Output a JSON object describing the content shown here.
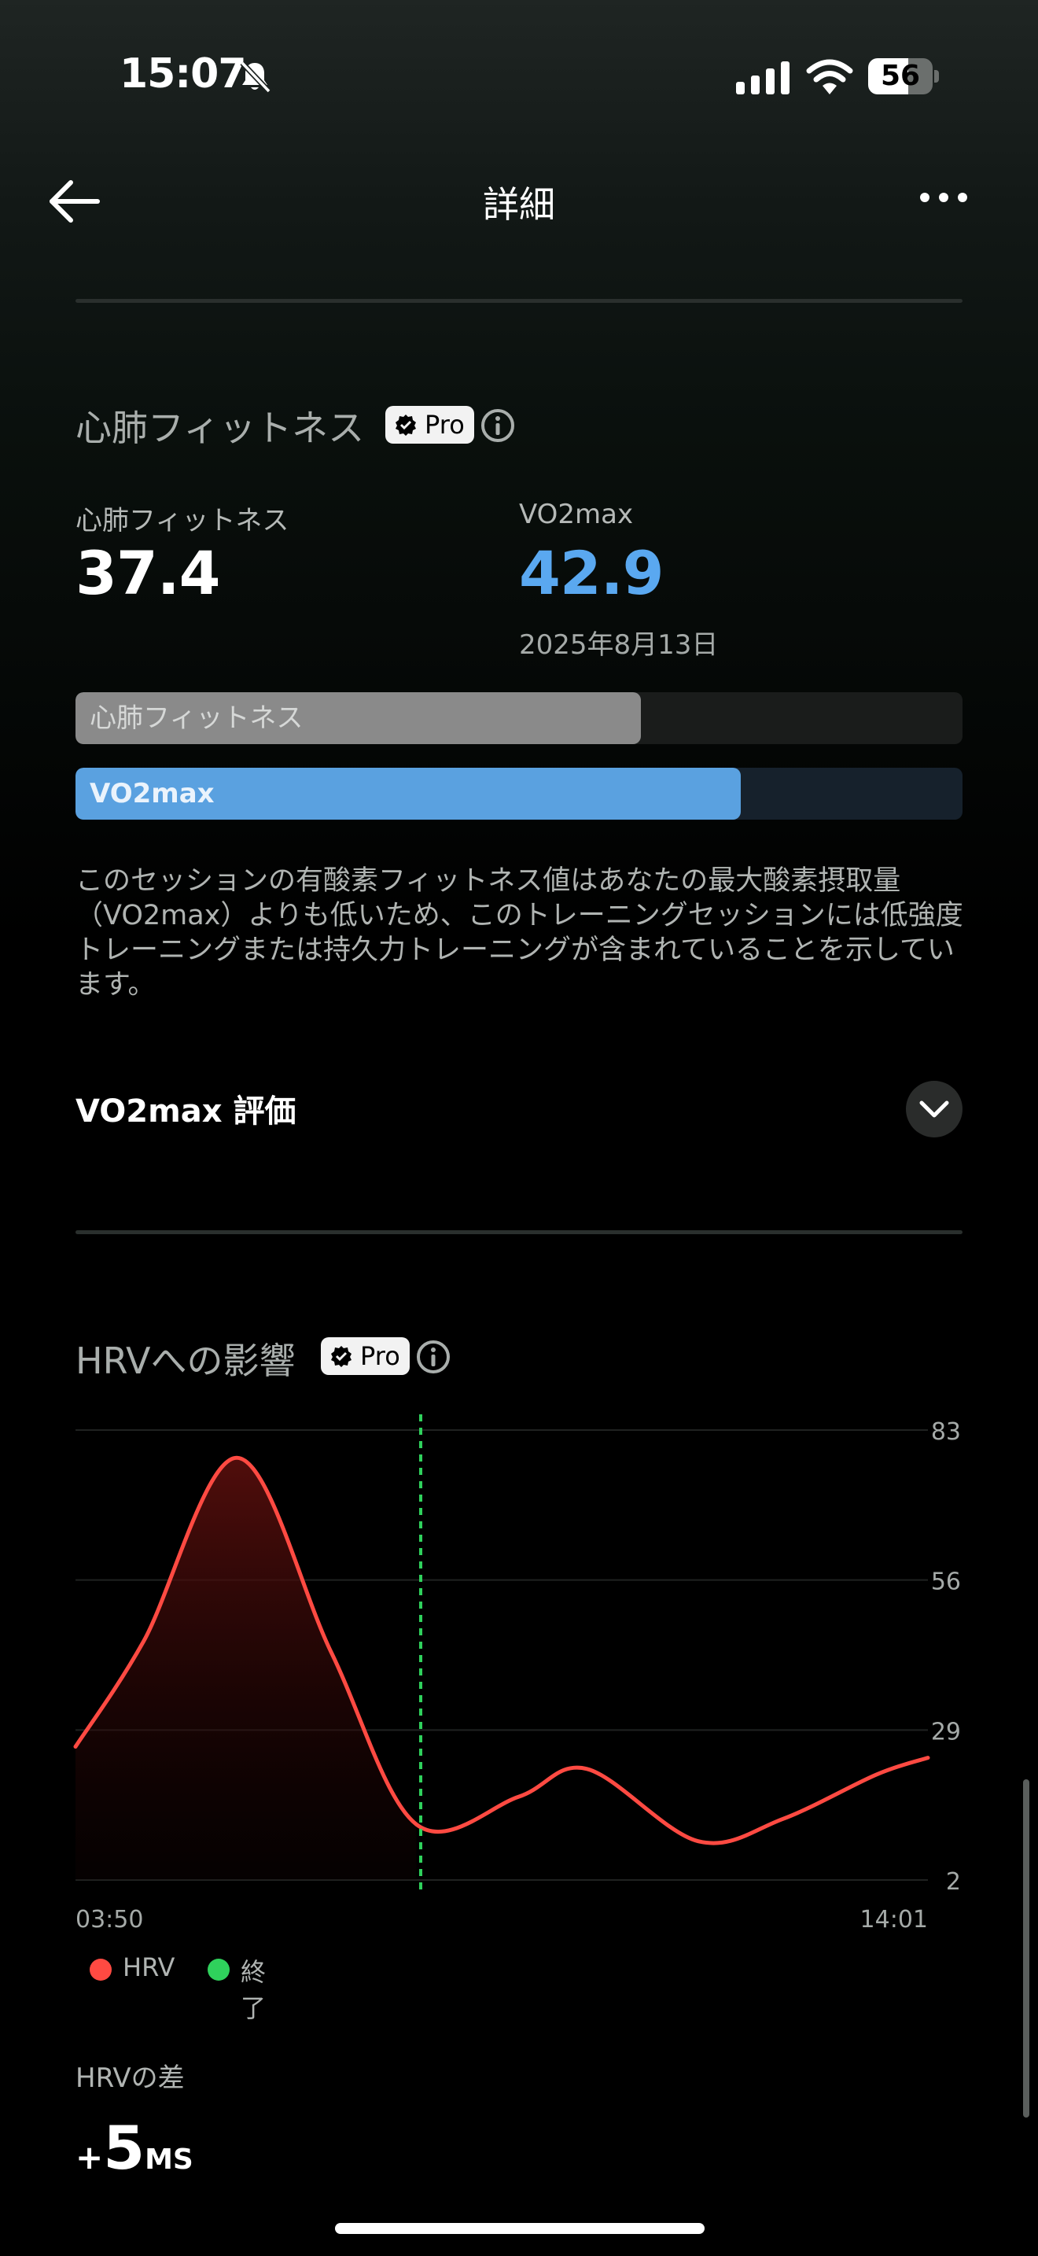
{
  "status": {
    "time": "15:07",
    "battery": "56"
  },
  "nav": {
    "title": "詳細"
  },
  "cardio": {
    "section_title": "心肺フィットネス",
    "pro_label": "Pro",
    "fitness_label": "心肺フィットネス",
    "fitness_value": "37.4",
    "vo2_label": "VO2max",
    "vo2_value": "42.9",
    "date": "2025年8月13日",
    "bars": [
      {
        "label": "心肺フィットネス",
        "fraction": 0.637,
        "fill": "#8a8a8a",
        "track": "#1a1c1b"
      },
      {
        "label": "VO2max",
        "fraction": 0.75,
        "fill": "#5aa1e0",
        "track": "#16212c"
      }
    ],
    "description": "このセッションの有酸素フィットネス値はあなたの最大酸素摂取量（VO2max）よりも低いため、このトレーニングセッションには低強度トレーニングまたは持久力トレーニングが含まれていることを示しています。",
    "vo2_rating_label": "VO2max 評価"
  },
  "hrv": {
    "section_title": "HRVへの影響",
    "pro_label": "Pro",
    "legend": [
      {
        "label": "HRV",
        "color": "#ff4a42"
      },
      {
        "label": "終了",
        "color": "#2fd15c"
      }
    ],
    "diff_label": "HRVの差",
    "diff_sign": "+",
    "diff_value": "5",
    "diff_unit": "MS"
  },
  "chart_data": {
    "type": "area",
    "series": [
      {
        "name": "HRV",
        "color": "#ff4a42",
        "x": [
          0,
          0.08,
          0.19,
          0.3,
          0.4,
          0.52,
          0.6,
          0.73,
          0.83,
          0.94,
          1.0
        ],
        "values": [
          26,
          45,
          78,
          43,
          12,
          17,
          22,
          9,
          13,
          21,
          24
        ]
      }
    ],
    "x_tick_labels": [
      "03:50",
      "14:01"
    ],
    "y_ticks": [
      83,
      56,
      29,
      2
    ],
    "ylim": [
      2,
      83
    ],
    "end_marker": {
      "label": "終了",
      "x": 0.405,
      "color": "#2fd15c"
    },
    "grid": true
  }
}
